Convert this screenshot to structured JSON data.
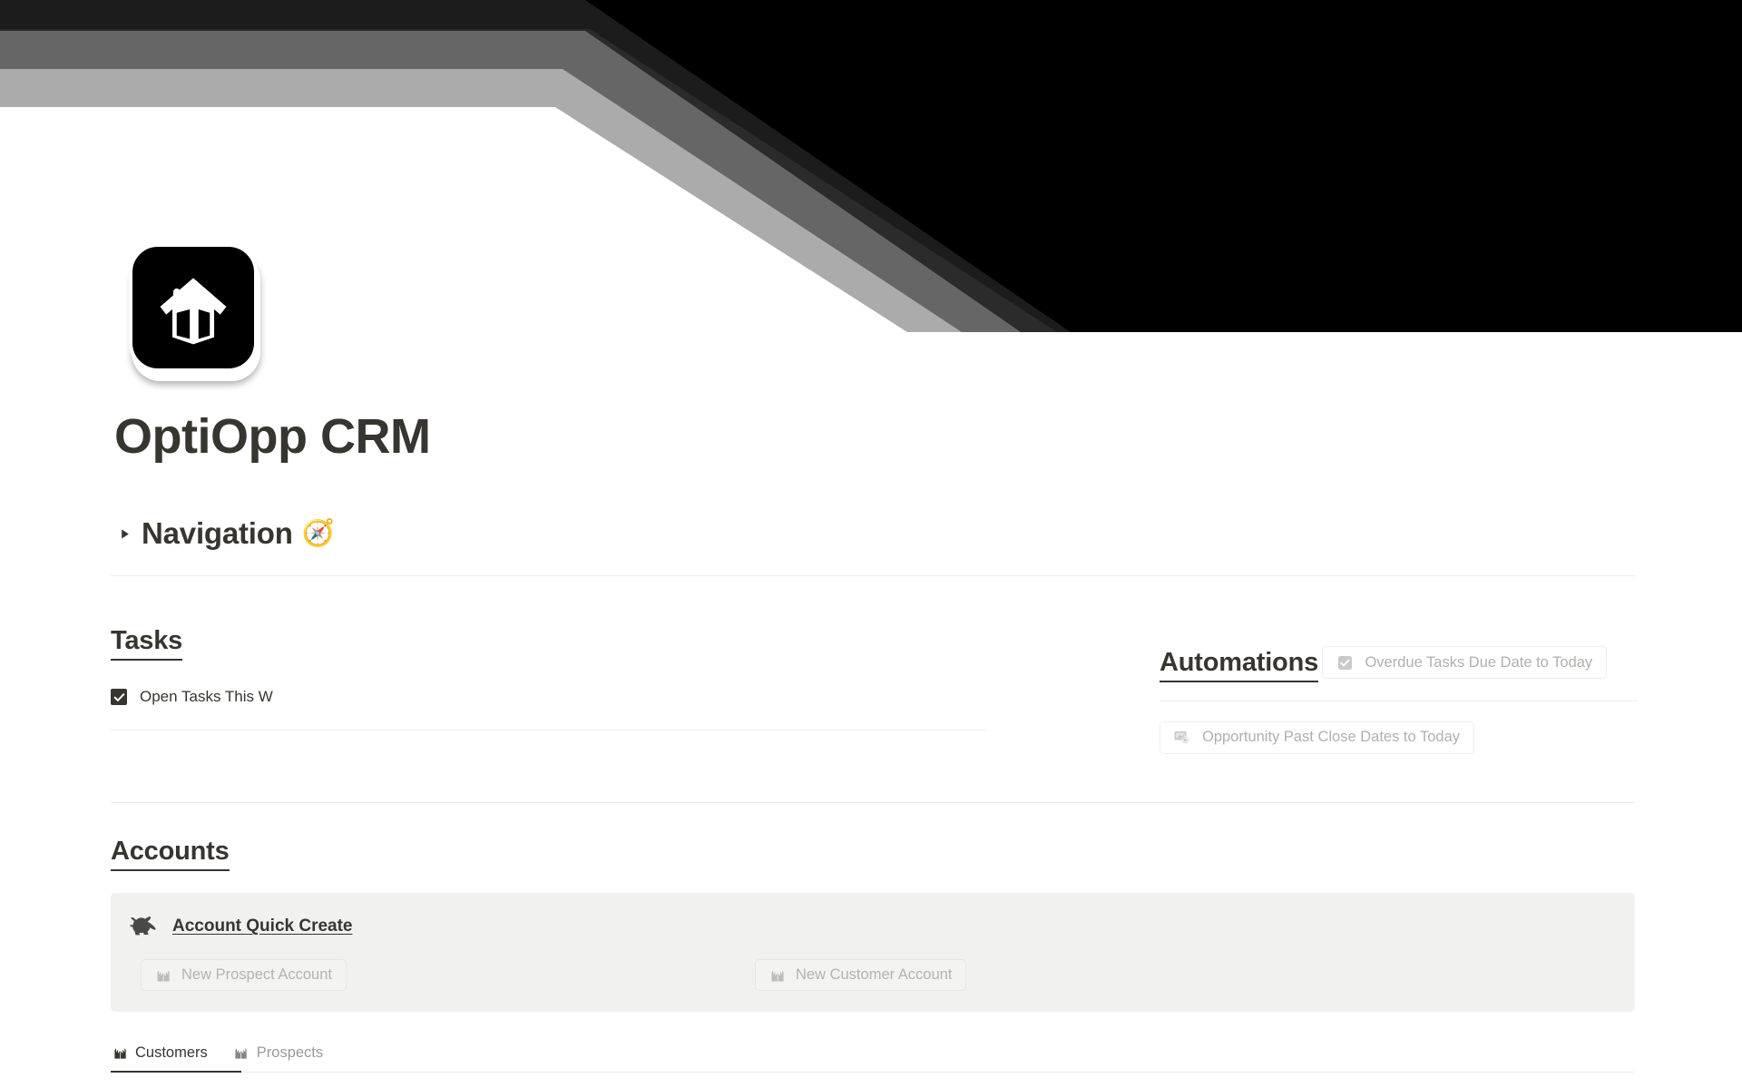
{
  "cover": {
    "name": "geometric-stripes-cover",
    "colors": [
      "#000000",
      "#1c1c1c",
      "#2b2b2b",
      "#666666",
      "#ababab",
      "#ffffff"
    ]
  },
  "header": {
    "icon_name": "house-icon",
    "title": "OptiOpp CRM"
  },
  "navigation": {
    "toggle_label": "Navigation",
    "emoji": "🧭",
    "collapsed": true
  },
  "tasks": {
    "heading": "Tasks",
    "items": [
      {
        "label": "Open Tasks This W",
        "checked": true
      }
    ]
  },
  "automations": {
    "heading": "Automations",
    "buttons": [
      {
        "label": "Overdue Tasks Due Date to Today",
        "icon": "checkbox-checked-icon"
      },
      {
        "label": "Opportunity Past Close Dates to Today",
        "icon": "money-refresh-icon"
      }
    ]
  },
  "accounts": {
    "heading": "Accounts",
    "callout": {
      "icon": "rabbit-icon",
      "link_label": "Account Quick Create",
      "background": "#f1f1ef",
      "buttons": [
        {
          "label": "New Prospect Account",
          "icon": "building-icon"
        },
        {
          "label": "New Customer Account",
          "icon": "building-icon"
        }
      ]
    }
  },
  "database_tabs": {
    "tabs": [
      {
        "label": "Customers",
        "icon": "building-icon",
        "active": true
      },
      {
        "label": "Prospects",
        "icon": "building-icon",
        "active": false
      }
    ]
  },
  "theme": {
    "text_primary": "#37352f",
    "text_muted": "#9b9a97",
    "text_disabled": "#b0b0ad",
    "divider": "#e9e9e7",
    "callout_bg": "#f1f1ef"
  }
}
